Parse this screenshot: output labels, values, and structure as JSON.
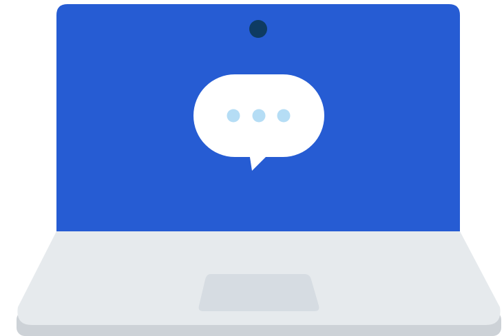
{
  "illustration": {
    "subject": "laptop-with-chat-bubble",
    "colors": {
      "screen": "#265CD3",
      "camera": "#0E3B62",
      "bubble": "#FFFFFF",
      "typing_dots": "#B5DDF5",
      "base_top": "#E6EAED",
      "base_edge": "#CDD2D7",
      "trackpad": "#D6DCE2",
      "background": "#FFFFFF"
    },
    "icons": [
      "laptop-icon",
      "webcam-icon",
      "speech-bubble-icon",
      "typing-indicator-icon",
      "trackpad-icon"
    ]
  }
}
